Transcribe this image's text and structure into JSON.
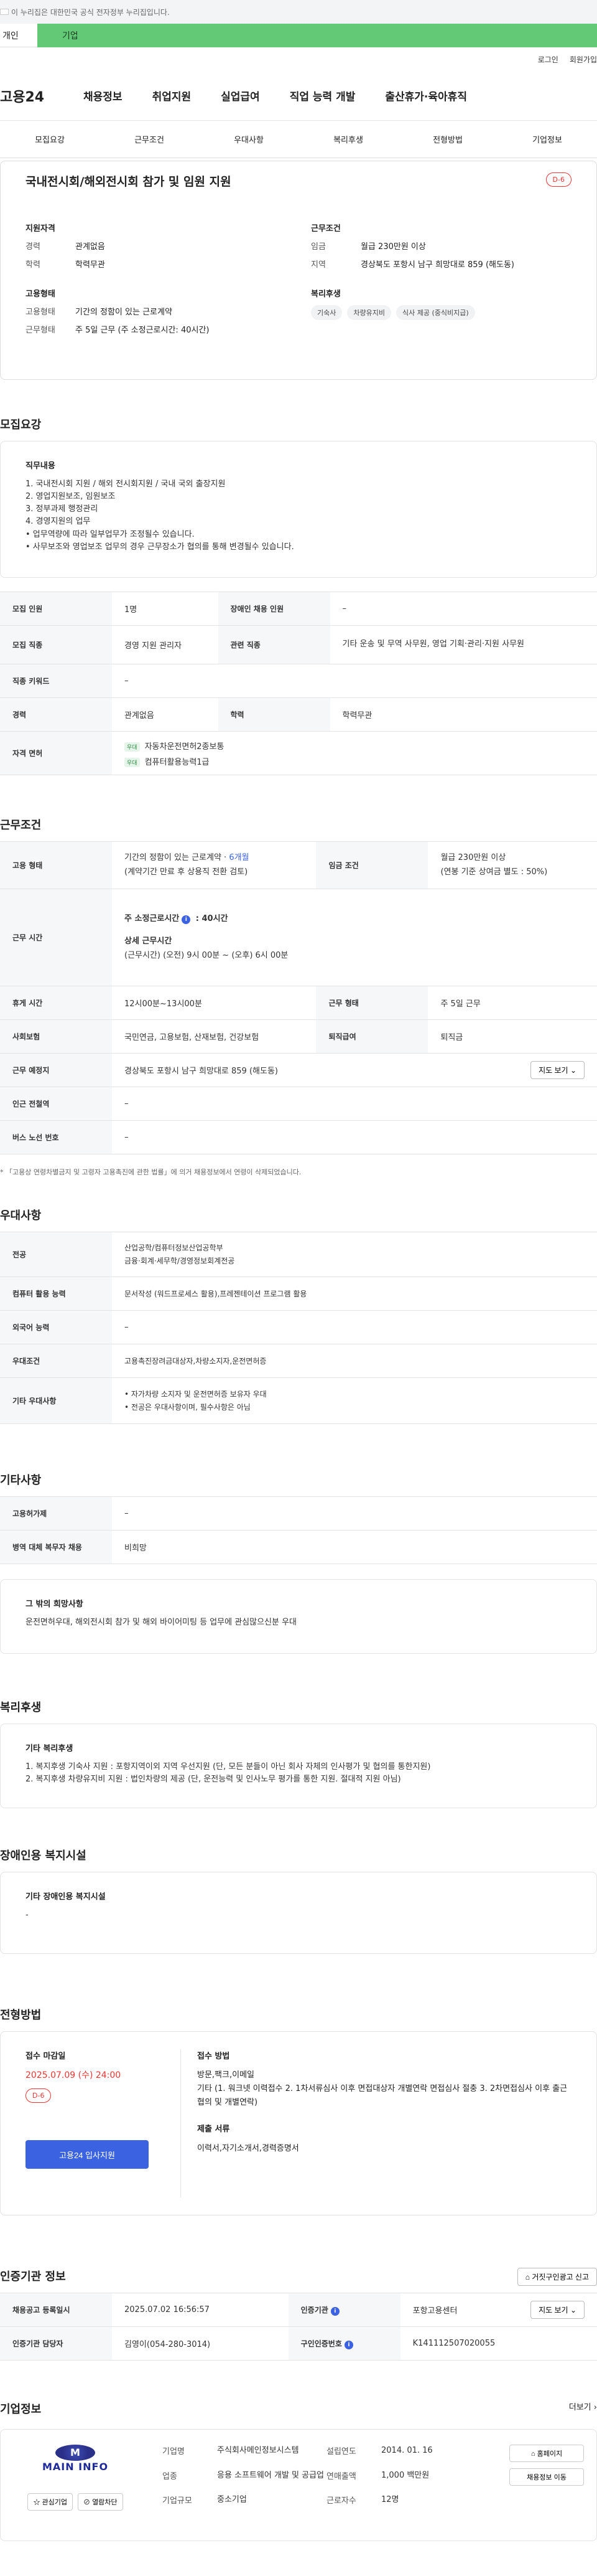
{
  "gov_bar": {
    "text": "이 누리집은 대한민국 공식 전자정부 누리집입니다."
  },
  "top_tabs": {
    "person": "개인",
    "company": "기업"
  },
  "util": {
    "login": "로그인",
    "join": "회원가입"
  },
  "gnb": {
    "logo": "고용24",
    "menu": [
      "채용정보",
      "취업지원",
      "실업급여",
      "직업 능력 개발",
      "출산휴가·육아휴직"
    ]
  },
  "subtabs": [
    "모집요강",
    "근무조건",
    "우대사항",
    "복리후생",
    "전형방법",
    "기업정보"
  ],
  "summary": {
    "title": "국내전시회/해외전시회 참가 및 임원 지원",
    "dday": "D-6",
    "qualification": {
      "heading": "지원자격",
      "rows": [
        {
          "k": "경력",
          "v": "관계없음"
        },
        {
          "k": "학력",
          "v": "학력무관"
        }
      ]
    },
    "work": {
      "heading": "근무조건",
      "rows": [
        {
          "k": "임금",
          "v": "월급 230만원 이상"
        },
        {
          "k": "지역",
          "v": "경상북도 포항시 남구 희망대로 859 (해도동)"
        }
      ]
    },
    "employment": {
      "heading": "고용형태",
      "rows": [
        {
          "k": "고용형태",
          "v": "기간의 정함이 있는 근로계약"
        },
        {
          "k": "근무형태",
          "v": "주 5일 근무 (주 소정근로시간: 40시간)"
        }
      ]
    },
    "welfare": {
      "heading": "복리후생",
      "tags": [
        "기숙사",
        "차량유지비",
        "식사 제공 (중식비지급)"
      ]
    }
  },
  "recruit": {
    "section_title": "모집요강",
    "duties_heading": "직무내용",
    "duties": [
      "1. 국내전시회 지원 / 해외 전시회지원 / 국내 국외 출장지원",
      "2. 영업지원보조, 임원보조",
      "3. 정부과제 행정관리",
      "4. 경영지원의 업무",
      "• 업무역량에 따라 일부업무가 조정될수 있습니다.",
      "• 사무보조와 영업보조 업무의 경우 근무장소가 협의를 통해 변경될수 있습니다."
    ],
    "headcount_label": "모집 인원",
    "headcount": "1명",
    "disabled_label": "장애인 채용 인원",
    "disabled": "–",
    "job_label": "모집 직종",
    "job": "경영 지원 관리자",
    "related_label": "관련 직종",
    "related": "기타 운송 및 무역 사무원, 영업 기획·관리·지원 사무원",
    "keyword_label": "직종 키워드",
    "keyword": "–",
    "career_label": "경력",
    "career": "관계없음",
    "edu_label": "학력",
    "edu": "학력무관",
    "license_label": "자격 면허",
    "licenses": [
      {
        "tag": "우대",
        "name": "자동차운전면허2종보통"
      },
      {
        "tag": "우대",
        "name": "컴퓨터활용능력1급"
      }
    ]
  },
  "conditions": {
    "section_title": "근무조건",
    "emp_type_label": "고용 형태",
    "emp_type": "기간의 정함이 있는 근로계약 · ",
    "emp_period": "6개월",
    "emp_type_sub": "(계약기간 만료 후 상용직 전환 검토)",
    "wage_label": "임금 조건",
    "wage": "월급 230만원 이상",
    "wage_sub": "(연봉 기준 상여금 별도 : 50%)",
    "hours_label": "근무 시간",
    "hours_weekly": "주 소정근로시간",
    "hours_weekly_value": " : 40시간",
    "hours_detail_title": "상세 근무시간",
    "hours_detail": "(근무시간) (오전) 9시 00분 ~ (오후) 6시 00분",
    "break_label": "휴게 시간",
    "break": "12시00분~13시00분",
    "shift_label": "근무 형태",
    "shift": "주 5일 근무",
    "insurance_label": "사회보험",
    "insurance": "국민연금, 고용보험, 산재보험, 건강보험",
    "severance_label": "퇴직급여",
    "severance": "퇴직금",
    "location_label": "근무 예정지",
    "location": "경상북도 포항시 남구 희망대로 859 (해도동)",
    "map_btn": "지도 보기",
    "subway_label": "인근 전철역",
    "subway": "–",
    "bus_label": "버스 노선 번호",
    "bus": "–",
    "footnote": "* 「고용상 연령차별금지 및 고령자 고용촉진에 관한 법률」에 의거 채용정보에서 연령이 삭제되었습니다."
  },
  "preferences": {
    "section_title": "우대사항",
    "major_label": "전공",
    "major": [
      "산업공학/컴퓨터정보산업공학부",
      "금융·회계·세무학/경영정보회계전공"
    ],
    "computer_label": "컴퓨터 활용 능력",
    "computer": "문서작성 (워드프로세스 활용),프레젠테이션 프로그램 활용",
    "language_label": "외국어 능력",
    "language": "–",
    "pref_label": "우대조건",
    "pref": "고용촉진장려금대상자,차량소지자,운전면허증",
    "other_label": "기타 우대사항",
    "other": [
      "• 자가차량 소지자 및 운전면허증 보유자 우대",
      "• 전공은 우대사항이며, 필수사항은 아님"
    ]
  },
  "etc": {
    "section_title": "기타사항",
    "employment_label": "고용허가제",
    "employment": "–",
    "military_label": "병역 대체 복무자 채용",
    "military": "비희망",
    "other_heading": "그 밖의 희망사항",
    "other": "운전면허우대,  해외전시회 참가 및 해외 바이어미팅 등 업무에 관심많으신분 우대"
  },
  "welfare": {
    "section_title": "복리후생",
    "heading": "기타 복리후생",
    "items": [
      "1. 복지후생 기숙사 지원 : 포항지역이외 지역 우선지원 (단, 모든 분들이 아닌 회사 자체의 인사평가 및 협의를 통한지원)",
      "2. 복지후생 차량유지비 지원 : 법인차량의 제공 (단, 운전능력 및 인사노무 평가를 통한 지원. 절대적 지원 아님)"
    ]
  },
  "disabled_welfare": {
    "section_title": "장애인용 복지시설",
    "heading": "기타 장애인용 복지시설",
    "value": "-"
  },
  "process": {
    "section_title": "전형방법",
    "deadline_label": "접수 마감일",
    "deadline": "2025.07.09 (수) 24:00",
    "dday": "D-6",
    "apply_btn": "고용24 입사지원",
    "method_label": "접수 방법",
    "method_lines": [
      "방문,팩크,이메일",
      "기타 (1. 워크넷 이력접수 2. 1차서류심사 이후 면접대상자 개별연락 면접심사 절충 3. 2차면접심사 이후 출근협의 및 개별연락)"
    ],
    "docs_label": "제출 서류",
    "docs": "이력서,자기소개서,경력증명서"
  },
  "agency": {
    "section_title": "인증기관 정보",
    "report_btn": "거짓구인광고 신고",
    "reg_date_label": "채용공고 등록일시",
    "reg_date": "2025.07.02 16:56:57",
    "agency_label": "인증기관",
    "agency": "포항고용센터",
    "map_btn": "지도 보기",
    "manager_label": "인증기관 담당자",
    "manager": "김영이(054-280-3014)",
    "number_label": "구인인증번호",
    "number": "K141112507020055"
  },
  "company": {
    "section_title": "기업정보",
    "more": "더보기",
    "logo_mark": "M",
    "logo_text": "MAIN INFO",
    "interest_btn": "관심기업",
    "block_btn": "열람차단",
    "name_label": "기업명",
    "name": "주식회사메인정보시스템",
    "industry_label": "업종",
    "industry": "응용 소프트웨어 개발 및 공급업",
    "size_label": "기업규모",
    "size": "중소기업",
    "founded_label": "설립연도",
    "founded": "2014. 01. 16",
    "revenue_label": "연매출액",
    "revenue": "1,000 백만원",
    "employees_label": "근로자수",
    "employees": "12명",
    "home_btn": "홈페이지",
    "jobs_btn": "채용정보 이동"
  }
}
